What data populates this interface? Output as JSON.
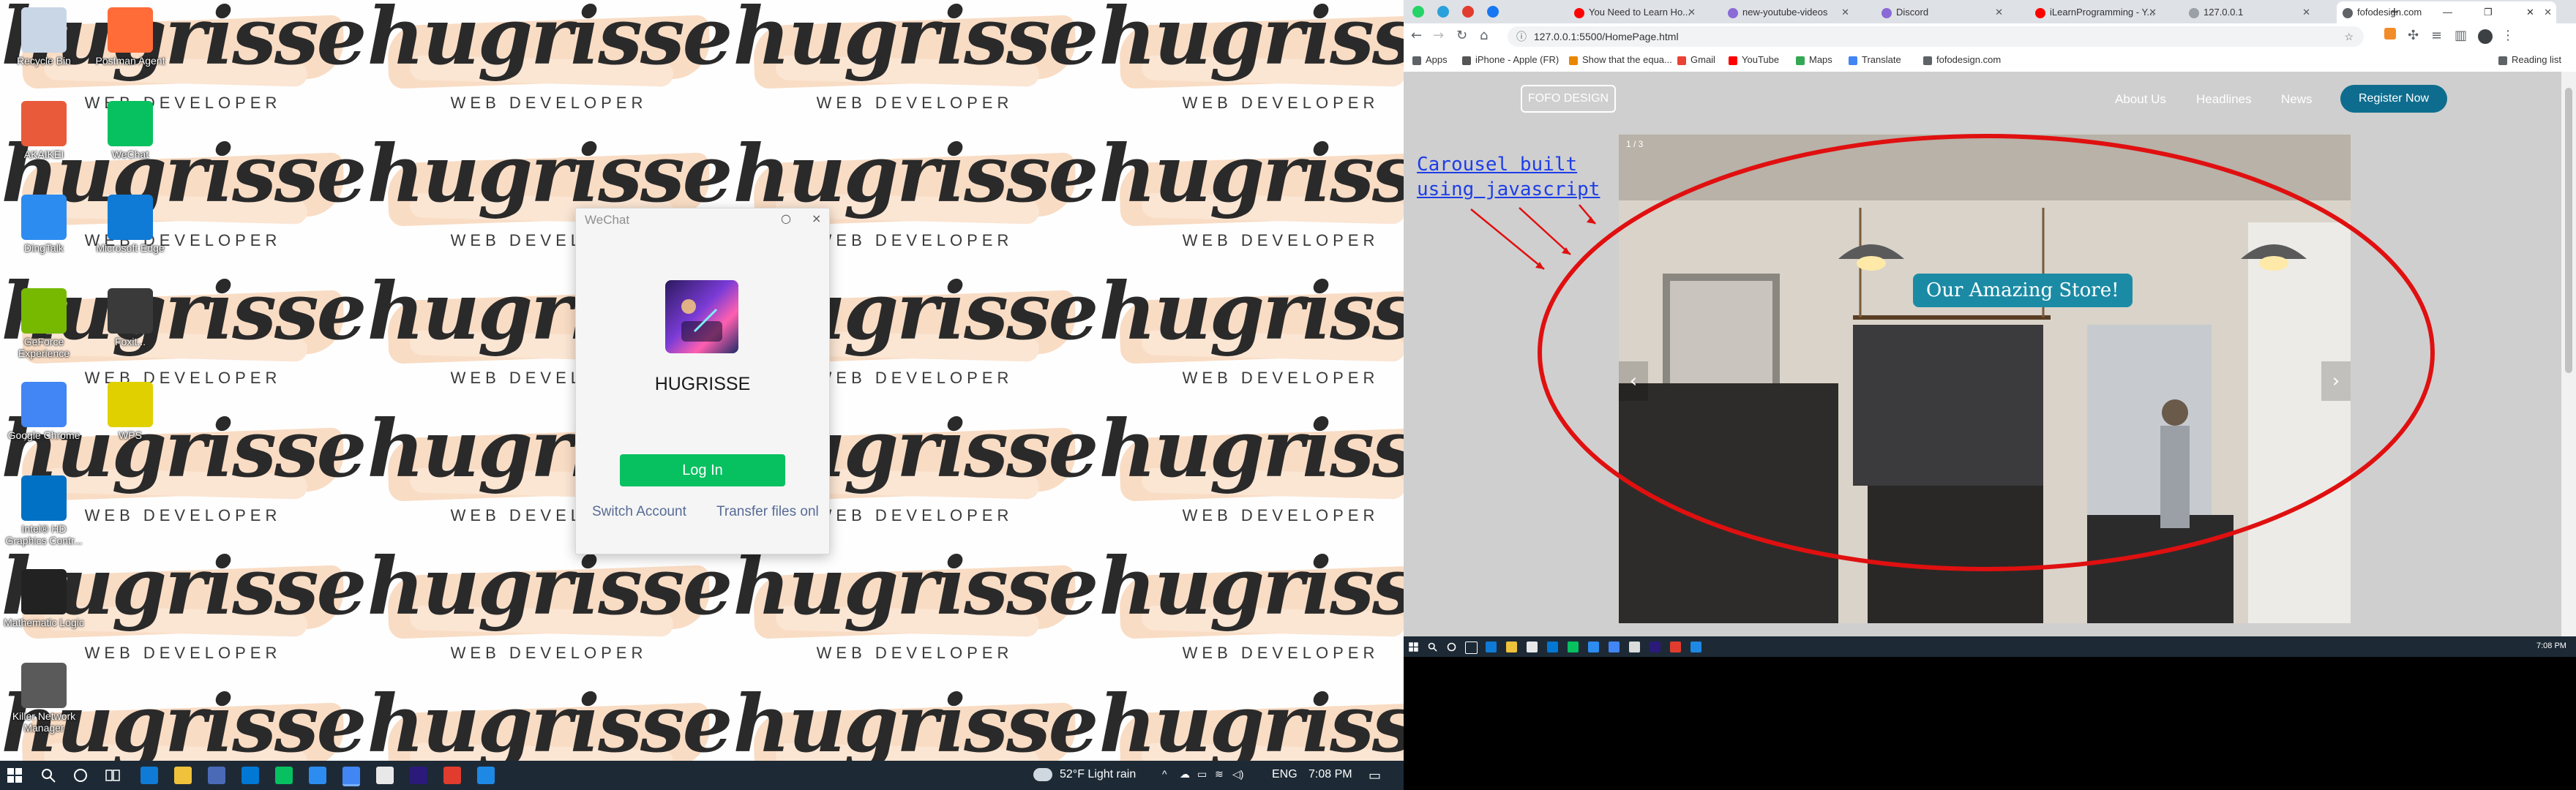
{
  "desktop": {
    "wallpaper_word": "hugrisse",
    "wallpaper_sub": "WEB DEVELOPER",
    "icons": [
      {
        "label": "Recycle Bin",
        "color": "#c9d6e6",
        "col": 0,
        "row": 0
      },
      {
        "label": "AKAIKEI",
        "color": "#e85a3a",
        "col": 0,
        "row": 1
      },
      {
        "label": "DingTalk",
        "color": "#2d8cf0",
        "col": 0,
        "row": 2
      },
      {
        "label": "GeForce Experience",
        "color": "#76b900",
        "col": 0,
        "row": 3
      },
      {
        "label": "Google Chrome",
        "color": "#4285f4",
        "col": 0,
        "row": 4
      },
      {
        "label": "Intel® HD Graphics Contr...",
        "color": "#0071c5",
        "col": 0,
        "row": 5
      },
      {
        "label": "Mathematic Logic",
        "color": "#222222",
        "col": 0,
        "row": 6
      },
      {
        "label": "Killer Network Manager",
        "color": "#5a5a5a",
        "col": 0,
        "row": 7
      },
      {
        "label": "Postman Agent",
        "color": "#ff6c37",
        "col": 1,
        "row": 0
      },
      {
        "label": "WeChat",
        "color": "#07c160",
        "col": 1,
        "row": 1
      },
      {
        "label": "Microsoft Edge",
        "color": "#0f7bd6",
        "col": 1,
        "row": 2
      },
      {
        "label": "Foxit...",
        "color": "#3a3a3a",
        "col": 1,
        "row": 3
      },
      {
        "label": "WPS",
        "color": "#e0d000",
        "col": 1,
        "row": 4
      }
    ]
  },
  "wechat": {
    "title": "WeChat",
    "settings_icon": "○",
    "close_icon": "×",
    "username": "HUGRISSE",
    "login_label": "Log In",
    "switch_label": "Switch Account",
    "transfer_label": "Transfer files onl"
  },
  "left_taskbar": {
    "weather": "52°F  Light rain",
    "lang": "ENG",
    "time": "7:08 PM"
  },
  "browser": {
    "tabs": [
      {
        "label": "You Need to Learn Ho...",
        "color": "#ff0000",
        "active": false
      },
      {
        "label": "new-youtube-videos",
        "color": "#8a6ad6",
        "active": false
      },
      {
        "label": "Discord",
        "color": "#8a6ad6",
        "active": false
      },
      {
        "label": "iLearnProgramming - Y...",
        "color": "#ff0000",
        "active": false
      },
      {
        "label": "127.0.0.1",
        "color": "#9aa0a6",
        "active": false
      },
      {
        "label": "fofodesign.com",
        "color": "#5f6368",
        "active": true
      }
    ],
    "pinned_tab_colors": [
      "#25d366",
      "#2aa1da",
      "#e23c2e",
      "#1877f2"
    ],
    "new_tab": "+",
    "url": "127.0.0.1:5500/HomePage.html",
    "bookmarks": [
      {
        "label": "Apps",
        "color": "#5f6368"
      },
      {
        "label": "iPhone - Apple (FR)",
        "color": "#555555"
      },
      {
        "label": "Show that the equa...",
        "color": "#ea8600"
      },
      {
        "label": "Gmail",
        "color": "#ea4335"
      },
      {
        "label": "YouTube",
        "color": "#ff0000"
      },
      {
        "label": "Maps",
        "color": "#34a853"
      },
      {
        "label": "Translate",
        "color": "#4285f4"
      },
      {
        "label": "fofodesign.com",
        "color": "#5f6368"
      }
    ],
    "reading_list": "Reading list"
  },
  "site": {
    "logo": "FOFO DESIGN",
    "nav": [
      "About Us",
      "Headlines",
      "News"
    ],
    "register": "Register Now",
    "carousel_caption": "Our Amazing Store!",
    "carousel_counter": "1 / 3",
    "prev": "‹",
    "next": "›",
    "annotation_line1": "Carousel built",
    "annotation_line2": "using javascript"
  },
  "right_taskbar": {
    "time": "7:08 PM"
  }
}
